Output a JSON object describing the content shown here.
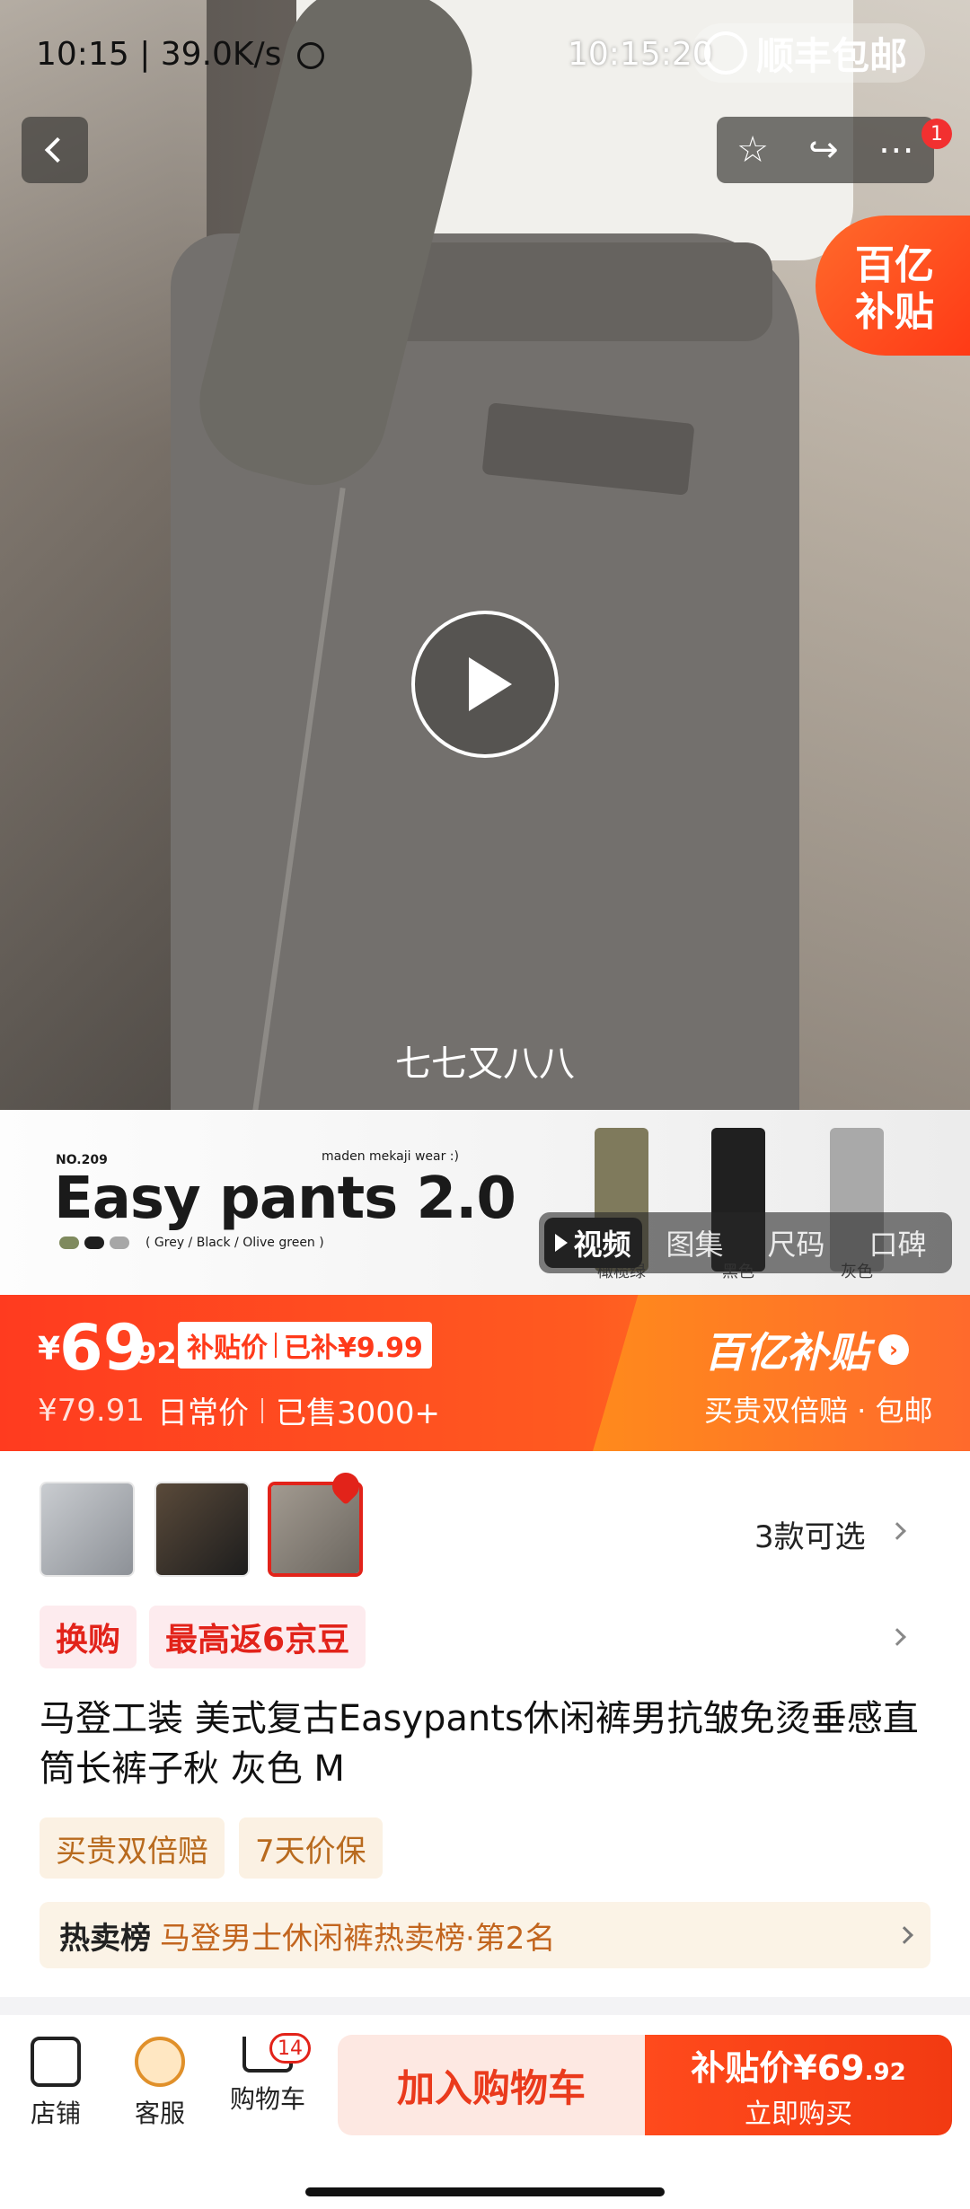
{
  "status_bar": {
    "time_speed": "10:15 | 39.0K/s",
    "overlay_time": "10:15:20"
  },
  "shipping_badge": {
    "label": "顺丰包邮"
  },
  "header": {
    "notification_count": "1",
    "icons": [
      "back-icon",
      "star-icon",
      "share-icon",
      "more-icon"
    ]
  },
  "subsidy_tag": {
    "line1": "百亿",
    "line2": "补贴"
  },
  "video": {
    "caption": "七七又八八"
  },
  "banner": {
    "number": "NO.209",
    "brand": "maden mekaji wear :)",
    "title": "Easy pants  2.0",
    "colors_note": "( Grey / Black / Olive green )",
    "colors": [
      "#7f8a5e",
      "#1f1f1f",
      "#a7a7a7"
    ],
    "variant_labels": [
      "橄榄绿",
      "黑色",
      "灰色"
    ]
  },
  "media_tabs": [
    "视频",
    "图集",
    "尺码",
    "口碑"
  ],
  "price": {
    "currency": "¥",
    "integer": "69",
    "decimal": ".92",
    "tag_label": "补贴价",
    "tag_extra": "已补¥9.99",
    "original": "¥79.91",
    "original_label": "日常价",
    "sold": "已售3000+",
    "brand": "百亿补贴",
    "brand_sub": "买贵双倍赔 · 包邮"
  },
  "variants": {
    "count_label": "3款可选"
  },
  "promo": [
    "换购",
    "最高返6京豆"
  ],
  "product_title": "马登工装 美式复古Easypants休闲裤男抗皱免烫垂感直筒长裤子秋 灰色 M",
  "guarantees": [
    "买贵双倍赔",
    "7天价保"
  ],
  "ranking": {
    "label": "热卖榜",
    "text": "马登男士休闲裤热卖榜·第2名"
  },
  "bottom_bar": {
    "store": "店铺",
    "service": "客服",
    "cart": "购物车",
    "cart_count": "14",
    "add_to_cart": "加入购物车",
    "buy_price_label": "补贴价¥69",
    "buy_price_decimal": ".92",
    "buy_now": "立即购买"
  },
  "colors": {
    "accent": "#ff3b1f",
    "red": "#e2231a"
  }
}
